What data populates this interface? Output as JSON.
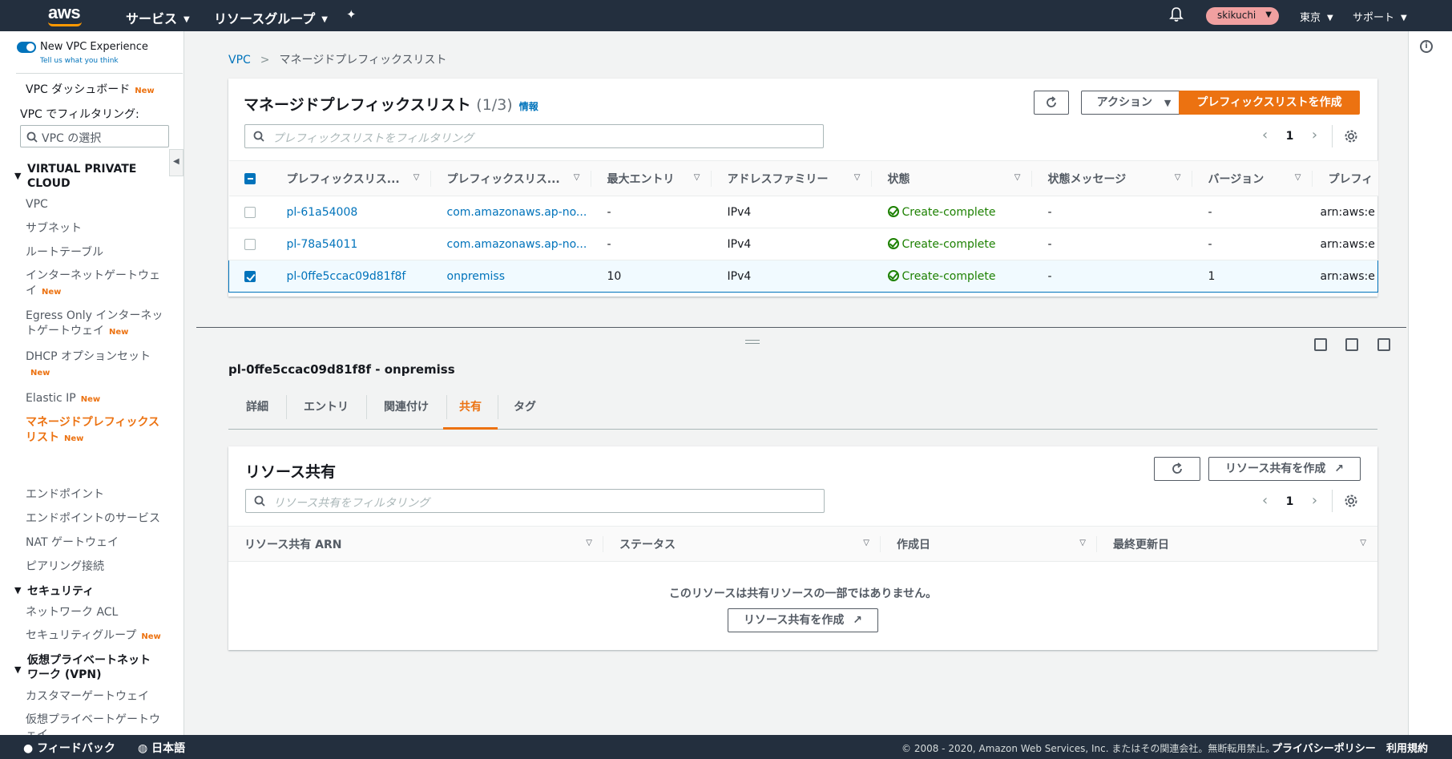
{
  "topnav": {
    "logo": "aws",
    "services": "サービス",
    "resource_groups": "リソースグループ",
    "user": "skikuchi",
    "region": "東京",
    "support": "サポート"
  },
  "sidebar": {
    "toggle_label": "New VPC Experience",
    "feedback_hint": "Tell us what you think",
    "dashboard": "VPC ダッシュボード",
    "filter_label": "VPC でフィルタリング:",
    "vpc_select_placeholder": "VPC の選択",
    "new_badge": "New",
    "group_vpc": "VIRTUAL PRIVATE CLOUD",
    "items_vpc": [
      "VPC",
      "サブネット",
      "ルートテーブル",
      "インターネットゲートウェイ",
      "Egress Only インターネットゲートウェイ",
      "DHCP オプションセット",
      "Elastic IP",
      "マネージドプレフィックスリスト",
      "エンドポイント",
      "エンドポイントのサービス",
      "NAT ゲートウェイ",
      "ピアリング接続"
    ],
    "group_security": "セキュリティ",
    "items_security": [
      "ネットワーク ACL",
      "セキュリティグループ"
    ],
    "group_vpn": "仮想プライベートネットワーク (VPN)",
    "items_vpn": [
      "カスタマーゲートウェイ",
      "仮想プライベートゲートウェイ"
    ]
  },
  "breadcrumb": {
    "root": "VPC",
    "current": "マネージドプレフィックスリスト"
  },
  "list_panel": {
    "title": "マネージドプレフィックスリスト",
    "count": "(1/3)",
    "info": "情報",
    "actions_label": "アクション",
    "create_label": "プレフィックスリストを作成",
    "filter_placeholder": "プレフィックスリストをフィルタリング",
    "page": "1",
    "columns": [
      "プレフィックスリス...",
      "プレフィックスリス...",
      "最大エントリ",
      "アドレスファミリー",
      "状態",
      "状態メッセージ",
      "バージョン",
      "プレフィ"
    ],
    "rows": [
      {
        "id": "pl-61a54008",
        "name": "com.amazonaws.ap-no...",
        "max": "-",
        "family": "IPv4",
        "state": "Create-complete",
        "message": "-",
        "version": "-",
        "arn": "arn:aws:e",
        "checked": false
      },
      {
        "id": "pl-78a54011",
        "name": "com.amazonaws.ap-no...",
        "max": "-",
        "family": "IPv4",
        "state": "Create-complete",
        "message": "-",
        "version": "-",
        "arn": "arn:aws:e",
        "checked": false
      },
      {
        "id": "pl-0ffe5ccac09d81f8f",
        "name": "onpremiss",
        "max": "10",
        "family": "IPv4",
        "state": "Create-complete",
        "message": "-",
        "version": "1",
        "arn": "arn:aws:e",
        "checked": true
      }
    ]
  },
  "detail": {
    "title": "pl-0ffe5ccac09d81f8f - onpremiss",
    "tabs": [
      "詳細",
      "エントリ",
      "関連付け",
      "共有",
      "タグ"
    ],
    "active_tab": "共有"
  },
  "share_panel": {
    "title": "リソース共有",
    "create_label": "リソース共有を作成",
    "filter_placeholder": "リソース共有をフィルタリング",
    "page": "1",
    "columns": [
      "リソース共有 ARN",
      "ステータス",
      "作成日",
      "最終更新日"
    ],
    "empty_message": "このリソースは共有リソースの一部ではありません。",
    "empty_button": "リソース共有を作成"
  },
  "footer": {
    "feedback": "フィードバック",
    "language": "日本語",
    "copyright": "© 2008 - 2020, Amazon Web Services, Inc. またはその関連会社。無断転用禁止。",
    "privacy": "プライバシーポリシー",
    "terms": "利用規約"
  },
  "colors": {
    "accent": "#ec7211",
    "link": "#0073bb",
    "success": "#1d8102",
    "nav_bg": "#232f3e"
  }
}
